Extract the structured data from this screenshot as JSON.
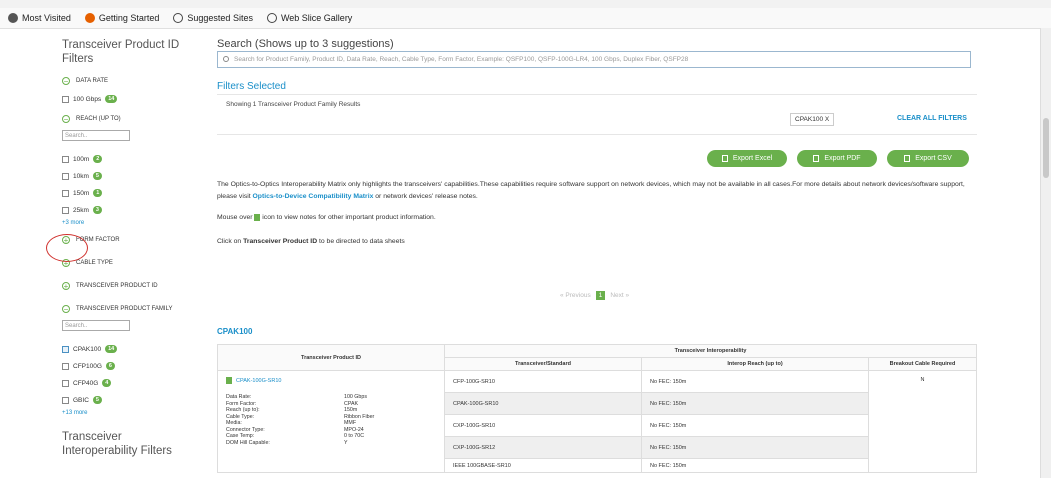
{
  "browser": {
    "bookmarks": [
      "Most Visited",
      "Getting Started",
      "Suggested Sites",
      "Web Slice Gallery"
    ]
  },
  "sidebar": {
    "title": "Transceiver Product ID Filters",
    "sections": {
      "data_rate": "DATA RATE",
      "reach": "REACH (up to)",
      "form_factor": "FORM FACTOR",
      "cable_type": "CABLE TYPE",
      "transceiver_product_id": "TRANSCEIVER PRODUCT ID",
      "transceiver_product_family": "TRANSCEIVER PRODUCT FAMILY"
    },
    "data_rate_items": [
      {
        "label": "100 Gbps",
        "count": "14"
      }
    ],
    "reach_search_placeholder": "Search..",
    "reach_items": [
      {
        "label": "100m",
        "count": "2"
      },
      {
        "label": "10km",
        "count": "5"
      },
      {
        "label": "150m",
        "count": "1"
      },
      {
        "label": "25km",
        "count": "3"
      }
    ],
    "reach_more": "+3 more",
    "family_search_placeholder": "Search..",
    "family_items": [
      {
        "label": "CPAK100",
        "count": "14",
        "checked": true
      },
      {
        "label": "CFP100G",
        "count": "6",
        "checked": false
      },
      {
        "label": "CFP40G",
        "count": "4",
        "checked": false
      },
      {
        "label": "GBIC",
        "count": "5",
        "checked": false
      }
    ],
    "family_more": "+13 more",
    "interop_title": "Transceiver Interoperability Filters"
  },
  "main": {
    "search_title": "Search (Shows up to 3 suggestions)",
    "search_placeholder": "Search for Product Family, Product ID, Data Rate, Reach, Cable Type, Form Factor,  Example: QSFP100, QSFP-100G-LR4, 100 Gbps, Duplex Fiber, QSFP28",
    "filters_selected": "Filters Selected",
    "showing": "Showing 1 Transceiver Product Family Results",
    "chip": "CPAK100 X",
    "clear_all": "CLEAR ALL FILTERS",
    "export_excel": "Export Excel",
    "export_pdf": "Export PDF",
    "export_csv": "Export CSV",
    "para1_a": "The Optics-to-Optics Interoperability Matrix only highlights the transceivers' capabilities.These capabilities require software support on network devices, which may not be available in all cases.For more details about network devices/software support, please visit ",
    "para1_link": "Optics-to-Device Compatibility Matrix",
    "para1_b": " or network devices' release notes.",
    "para2_a": "Mouse over ",
    "para2_b": " icon to view notes for other important product information.",
    "para3_a": "Click on ",
    "para3_bold": "Transceiver Product ID",
    "para3_b": " to be directed to data sheets",
    "pager": {
      "prev": "« Previous",
      "page": "1",
      "next": "Next »"
    },
    "family_heading": "CPAK100"
  },
  "table": {
    "group_header": "Transceiver Interoperability",
    "col_pid": "Transceiver Product ID",
    "col_std": "Transceiver/Standard",
    "col_reach": "Interop Reach (up to)",
    "col_breakout": "Breakout Cable Required",
    "pid": "CPAK-100G-SR10",
    "specs": [
      [
        "Data Rate:",
        "100 Gbps"
      ],
      [
        "Form Factor:",
        "CPAK"
      ],
      [
        "Reach (up to):",
        "150m"
      ],
      [
        "Cable Type:",
        "Ribbon Fiber"
      ],
      [
        "Media:",
        "MMF"
      ],
      [
        "Connector Type:",
        "MPO-24"
      ],
      [
        "Case Temp:",
        "0 to 70C"
      ],
      [
        "DOM Hill Capable:",
        "Y"
      ]
    ],
    "rows": [
      {
        "std": "CFP-100G-SR10",
        "reach": "No FEC: 150m"
      },
      {
        "std": "CPAK-100G-SR10",
        "reach": "No FEC: 150m"
      },
      {
        "std": "CXP-100G-SR10",
        "reach": "No FEC: 150m"
      },
      {
        "std": "CXP-100G-SR12",
        "reach": "No FEC: 150m"
      },
      {
        "std": "IEEE 100GBASE-SR10",
        "reach": "No FEC: 150m"
      }
    ],
    "breakout": "N"
  },
  "colors": {
    "accent_green": "#6ab04c",
    "link_blue": "#1a8fc9",
    "annotation_red": "#d0312d"
  }
}
